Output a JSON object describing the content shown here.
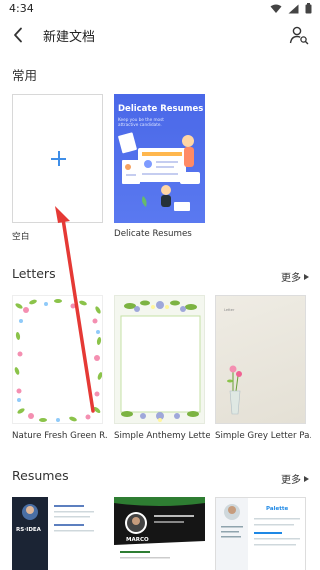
{
  "status_bar": {
    "time": "4:34",
    "icons": [
      "wifi-icon",
      "signal-icon",
      "battery-icon"
    ]
  },
  "app_bar": {
    "title": "新建文档",
    "back_icon": "back-arrow-icon",
    "account_icon": "account-search-icon"
  },
  "sections": {
    "common": {
      "title": "常用",
      "items": [
        {
          "label": "空白",
          "thumb_icon": "plus-icon"
        },
        {
          "label": "Delicate Resumes",
          "thumb_title": "Delicate Resumes",
          "thumb_subtitle": "Keep you be the most attractive candidate."
        }
      ]
    },
    "letters": {
      "title": "Letters",
      "more": "更多",
      "items": [
        {
          "label": "Nature Fresh Green R..."
        },
        {
          "label": "Simple Anthemy Letter..."
        },
        {
          "label": "Simple Grey Letter Pa...",
          "thumb_text": "Letter"
        }
      ]
    },
    "resumes": {
      "title": "Resumes",
      "more": "更多",
      "items": [
        {
          "thumb_text": "RS·IDEA"
        },
        {
          "thumb_text": "MARCO"
        },
        {
          "thumb_text": "Palette"
        }
      ]
    }
  },
  "colors": {
    "accent": "#3f8ee8",
    "annotation_arrow": "#e53935",
    "delicate_bg": "#4a68e8"
  }
}
